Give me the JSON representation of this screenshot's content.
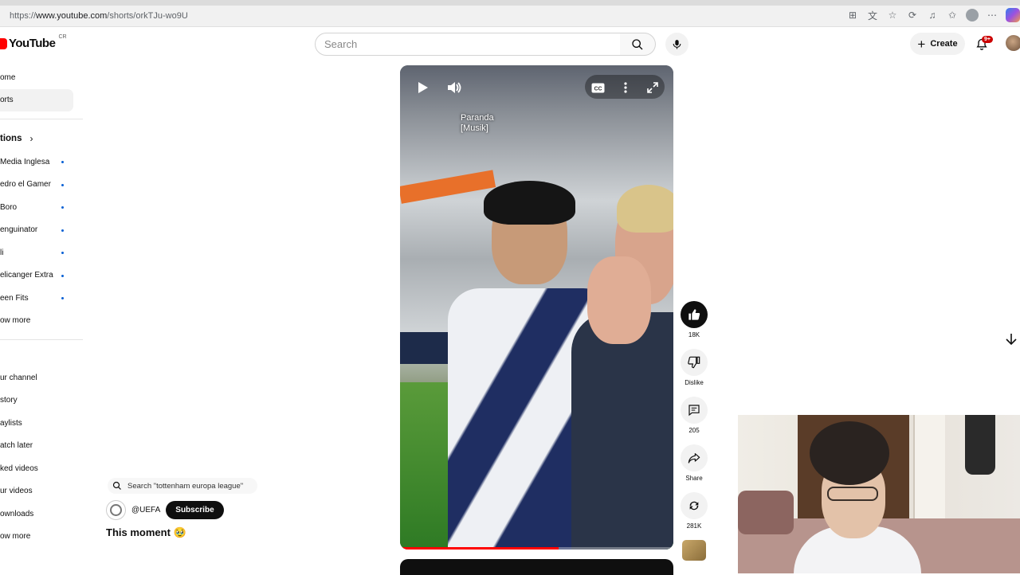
{
  "browser": {
    "url_prefix": "https://",
    "url_domain": "www.youtube.com",
    "url_path": "/shorts/orkTJu-wo9U"
  },
  "header": {
    "logo_text": "YouTube",
    "country_code": "CR",
    "search_placeholder": "Search",
    "create_label": "Create",
    "notifications_badge": "9+"
  },
  "sidebar": {
    "main": [
      {
        "label": "ome",
        "active": false
      },
      {
        "label": "orts",
        "active": true
      }
    ],
    "subscriptions_heading": "tions",
    "subscriptions": [
      {
        "label": "Media Inglesa"
      },
      {
        "label": "edro el Gamer"
      },
      {
        "label": "Boro"
      },
      {
        "label": "enguinator"
      },
      {
        "label": "li"
      },
      {
        "label": "elicanger Extra"
      },
      {
        "label": "een Fits"
      }
    ],
    "subscriptions_more": "ow more",
    "you_items": [
      {
        "label": "ur channel"
      },
      {
        "label": "story"
      },
      {
        "label": "aylists"
      },
      {
        "label": "atch later"
      },
      {
        "label": "ked videos"
      },
      {
        "label": "ur videos"
      },
      {
        "label": "ownloads"
      }
    ],
    "you_more": "ow more"
  },
  "short": {
    "music_line1": "Paranda",
    "music_line2": "[Musik]",
    "progress": 0.58,
    "search_suggestion": "Search \"tottenham europa league\"",
    "channel": "@UEFA",
    "subscribe_label": "Subscribe",
    "title": "This moment 🥹"
  },
  "actions": {
    "like_count": "18K",
    "dislike_label": "Dislike",
    "comment_count": "205",
    "share_label": "Share",
    "remix_count": "281K"
  },
  "icons": {
    "play": "play-icon",
    "volume": "volume-icon",
    "captions": "cc-icon",
    "more": "more-vert-icon",
    "fullscreen": "fullscreen-icon",
    "down": "arrow-down-icon"
  }
}
